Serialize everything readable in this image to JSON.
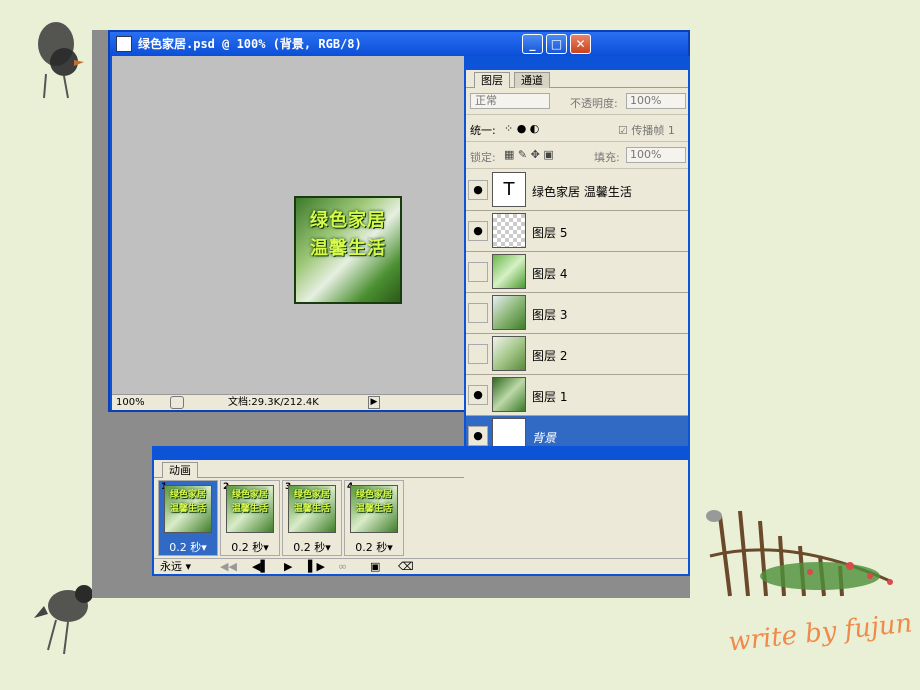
{
  "document": {
    "title": "绿色家居.psd @ 100% (背景, RGB/8)",
    "canvas_text_line1": "绿色家居",
    "canvas_text_line2": "温馨生活",
    "zoom": "100%",
    "doc_info": "文档:29.3K/212.4K",
    "minimize_glyph": "_",
    "maximize_glyph": "□",
    "close_glyph": "✕"
  },
  "layers_panel": {
    "tabs": [
      "图层",
      "通道"
    ],
    "blend_mode": "正常",
    "opacity_label": "不透明度:",
    "opacity_value": "100%",
    "unify_label": "统一:",
    "propagate_label": "传播帧 1",
    "lock_label": "锁定:",
    "fill_label": "填充:",
    "fill_value": "100%",
    "layers": [
      {
        "name": "绿色家居 温馨生活",
        "type_glyph": "T",
        "visible": true
      },
      {
        "name": "图层 5",
        "visible": true
      },
      {
        "name": "图层 4",
        "visible": false
      },
      {
        "name": "图层 3",
        "visible": false
      },
      {
        "name": "图层 2",
        "visible": false
      },
      {
        "name": "图层 1",
        "visible": true
      },
      {
        "name": "背景",
        "visible": true,
        "selected": true
      }
    ]
  },
  "animation_panel": {
    "tab": "动画",
    "frames": [
      {
        "number": "1",
        "delay": "0.2 秒"
      },
      {
        "number": "2",
        "delay": "0.2 秒"
      },
      {
        "number": "3",
        "delay": "0.2 秒"
      },
      {
        "number": "4",
        "delay": "0.2 秒"
      }
    ],
    "loop": "永远"
  },
  "signature": "write by fujun",
  "colors": {
    "accent": "#316ac5",
    "title_bar": "#0c53d8",
    "canvas_text": "#d9f94a"
  }
}
